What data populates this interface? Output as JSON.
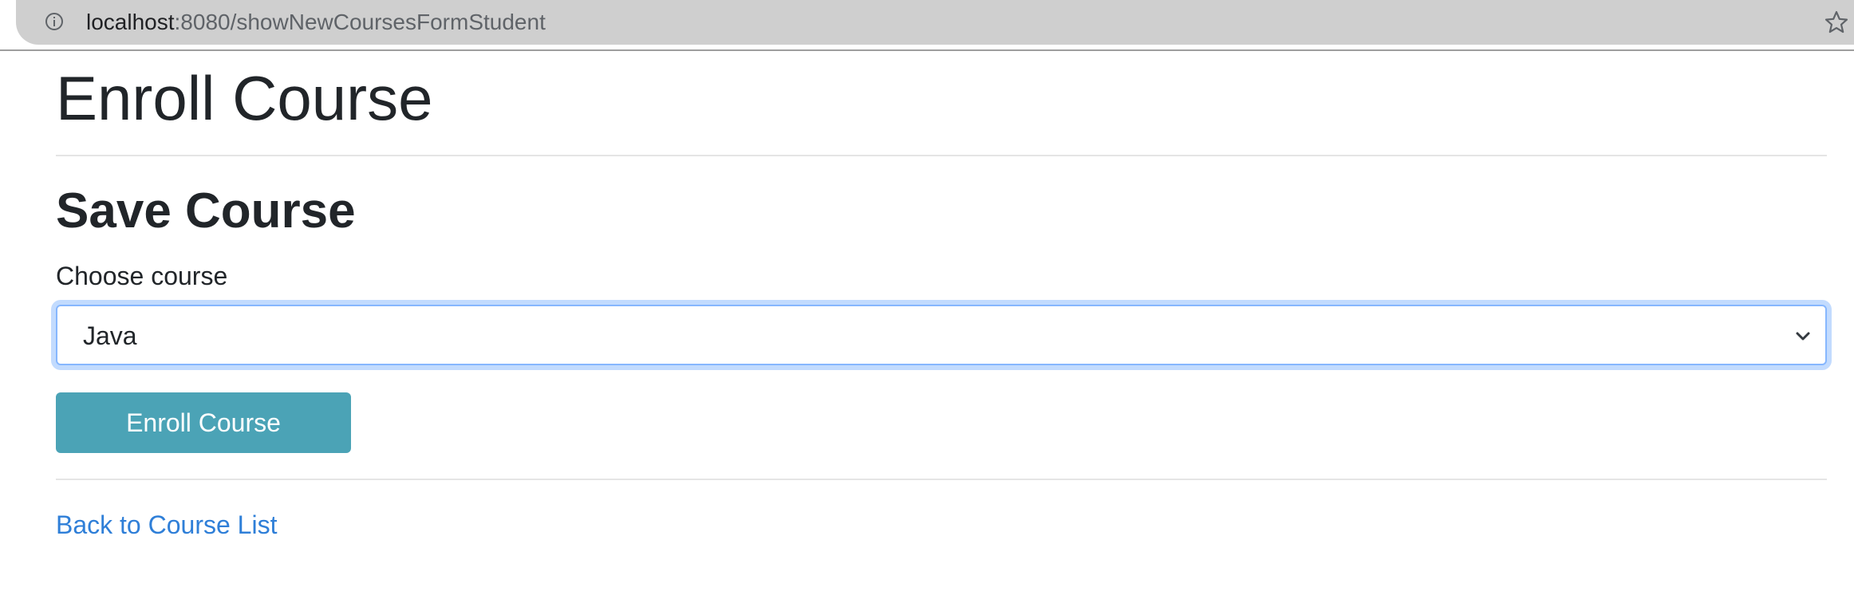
{
  "browser": {
    "url_host": "localhost",
    "url_path": ":8080/showNewCoursesFormStudent",
    "info_icon": "info-icon",
    "bookmark_icon": "star-icon"
  },
  "page": {
    "title": "Enroll Course",
    "section_title": "Save Course"
  },
  "form": {
    "course_label": "Choose course",
    "course_selected": "Java",
    "submit_label": "Enroll Course"
  },
  "links": {
    "back_label": "Back to Course List"
  },
  "colors": {
    "button": "#4ba3b6",
    "link": "#2f7fd8",
    "focus_border": "#86b7fe"
  }
}
